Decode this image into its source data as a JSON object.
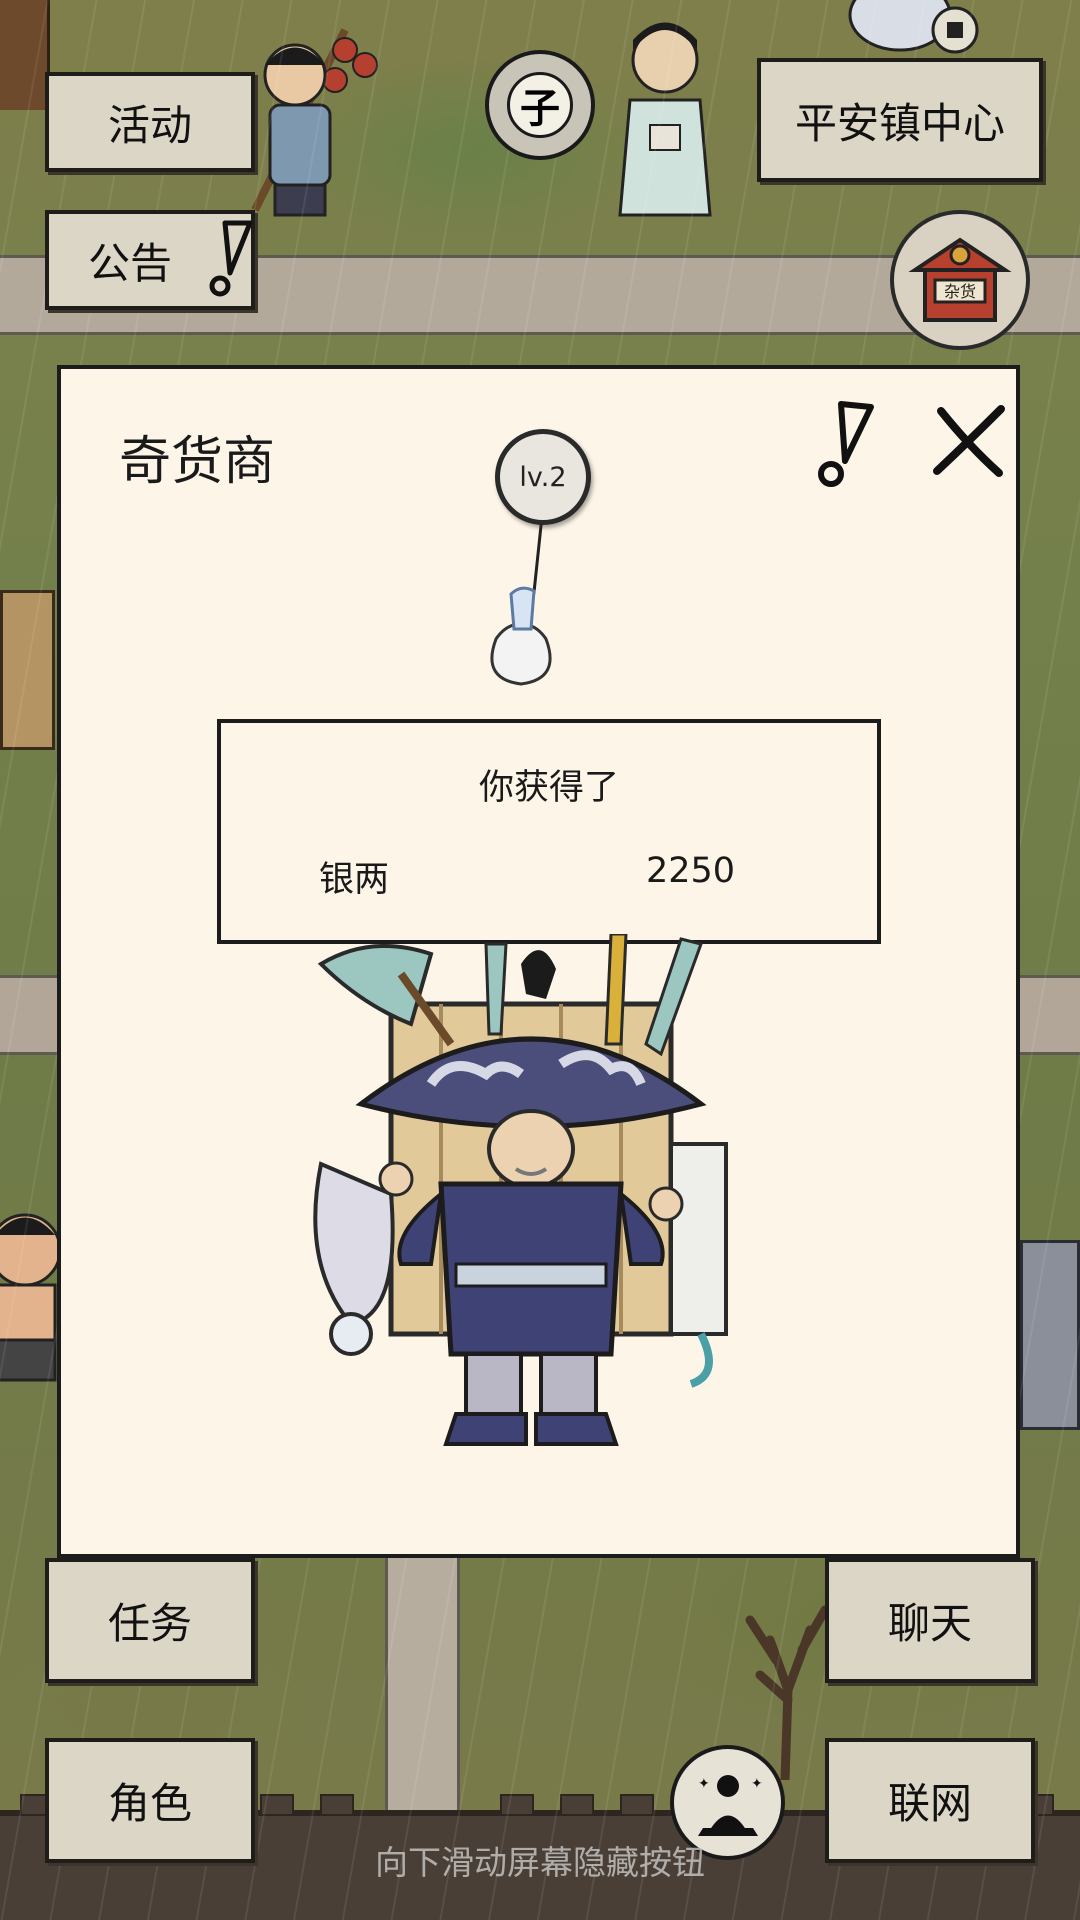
{
  "top_left": {
    "activity_label": "活动",
    "notice_label": "公告"
  },
  "top_right": {
    "location_label": "平安镇中心"
  },
  "time_glyph": "子",
  "shop_icon_text": "杂货",
  "dialog": {
    "title": "奇货商",
    "level": "lv.2",
    "reward_heading": "你获得了",
    "reward_item": "银两",
    "reward_amount": "2250"
  },
  "bottom_left": {
    "task_label": "任务",
    "role_label": "角色"
  },
  "bottom_right": {
    "chat_label": "聊天",
    "online_label": "联网"
  },
  "hint": "向下滑动屏幕隐藏按钮",
  "colors": {
    "button_bg": "#dcd6c7",
    "dialog_bg": "#fcf5e8",
    "outline": "#1c1c1c",
    "grass": "#74804b",
    "road": "#b3a99b"
  },
  "icons": [
    "alert-icon",
    "close-icon",
    "meditate-icon",
    "shop-icon",
    "time-icon",
    "money-sack-icon"
  ]
}
